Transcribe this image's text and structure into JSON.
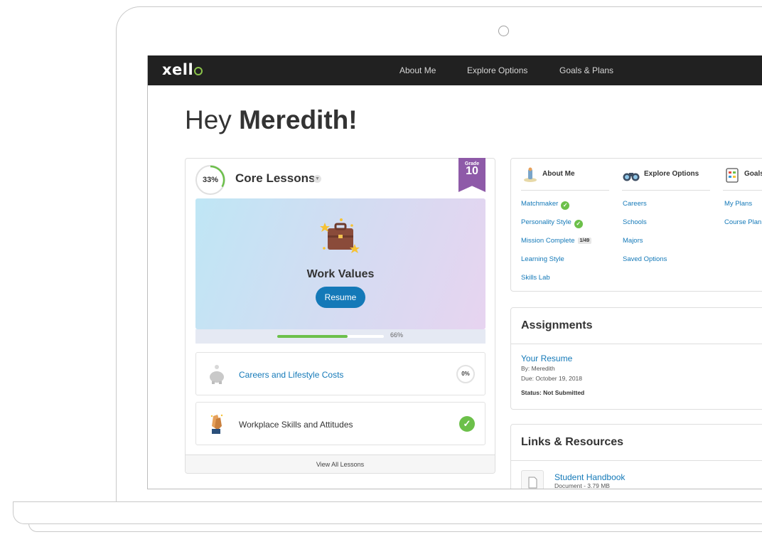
{
  "app": {
    "logo": "xell",
    "logo_o": "o"
  },
  "nav": {
    "about_me": "About Me",
    "explore_options": "Explore Options",
    "goals_plans": "Goals & Plans"
  },
  "greeting": {
    "prefix": "Hey ",
    "name": "Meredith!"
  },
  "core_lessons": {
    "percent": "33%",
    "percent_value": 0.33,
    "title": "Core Lessons",
    "grade_label": "Grade",
    "grade": "10",
    "featured": {
      "title": "Work Values",
      "button": "Resume",
      "progress_label": "66%",
      "progress_value": 0.66
    },
    "lessons": [
      {
        "label": "Careers and Lifestyle Costs",
        "status": "0%"
      },
      {
        "label": "Workplace Skills and Attitudes",
        "status": "complete"
      }
    ],
    "view_all": "View All Lessons"
  },
  "quick_nav": {
    "columns": [
      {
        "heading": "About Me",
        "links": [
          "Matchmaker",
          "Personality Style",
          "Mission Complete",
          "Learning Style",
          "Skills Lab"
        ],
        "mission_badge": "1/49"
      },
      {
        "heading": "Explore Options",
        "links": [
          "Careers",
          "Schools",
          "Majors",
          "Saved Options"
        ]
      },
      {
        "heading": "Goals",
        "links": [
          "My Plans",
          "Course Plan"
        ]
      }
    ]
  },
  "assignments": {
    "title": "Assignments",
    "item": {
      "name": "Your Resume",
      "by": "By: Meredith",
      "due": "Due: October 19, 2018",
      "status": "Status: Not Submitted"
    }
  },
  "links_resources": {
    "title": "Links & Resources",
    "item": {
      "name": "Student Handbook",
      "meta": "Document - 3.79 MB"
    }
  },
  "colors": {
    "topbar": "#212121",
    "accent_green": "#6cc04a",
    "link_blue": "#1479b8",
    "grade_purple": "#8e5aa8"
  },
  "icons": [
    "briefcase-icon",
    "piggy-bank-icon",
    "clapping-hands-icon",
    "about-me-icon",
    "binoculars-icon",
    "goals-icon",
    "document-icon",
    "chevron-down-icon",
    "check-icon"
  ]
}
